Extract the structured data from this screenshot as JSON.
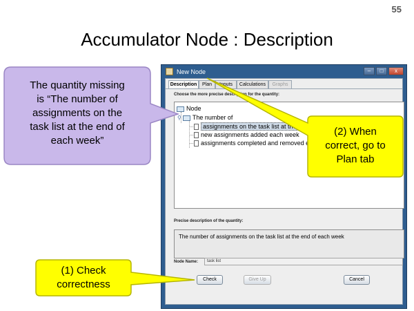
{
  "slide": {
    "number": "55",
    "title": "Accumulator Node : Description"
  },
  "window": {
    "title": "New Node",
    "buttons": [
      "–",
      "□",
      "x"
    ],
    "tabs": [
      {
        "label": "Description",
        "state": "active"
      },
      {
        "label": "Plan",
        "state": "normal"
      },
      {
        "label": "Inputs",
        "state": "normal"
      },
      {
        "label": "Calculations",
        "state": "normal"
      },
      {
        "label": "Graphs",
        "state": "disabled"
      }
    ],
    "tree_heading": "Choose the more precise description for the quantity:",
    "tree": {
      "root": "Node",
      "child": "The number of",
      "leaves": [
        "assignments on the task list at the end of each week",
        "new assignments added each week",
        "assignments completed and removed each week"
      ]
    },
    "desc_heading": "Precise description of the quantity:",
    "description": "The number of assignments on the task list at the end of each week",
    "node_name_label": "Node Name:",
    "node_name_value": "task list",
    "actions": {
      "check": "Check",
      "give_up": "Give Up",
      "cancel": "Cancel"
    }
  },
  "callouts": {
    "quantity": [
      "The quantity missing",
      "is “The number of",
      "assignments on the",
      "task list at the end of",
      "each week”"
    ],
    "plan": [
      "(2) When",
      "correct, go to",
      "Plan tab"
    ],
    "check": [
      "(1) Check",
      "correctness"
    ]
  },
  "colors": {
    "purple_callout": "#c9b8ea",
    "yellow_callout": "#ffff00",
    "window_frame": "#2e5d8f"
  }
}
